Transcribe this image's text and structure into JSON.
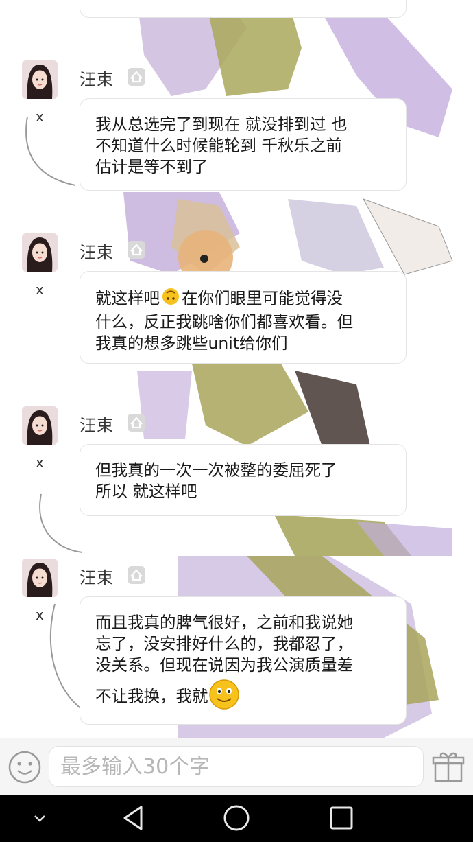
{
  "messages": [
    {
      "name": "汪束",
      "mark": "x",
      "lines": [
        "我从总选完了到现在 就没排到过 也",
        "不知道什么时候能轮到 千秋乐之前",
        "估计是等不到了"
      ]
    },
    {
      "name": "汪束",
      "mark": "x",
      "lines_a": "就这样吧",
      "emoji_a": "upside-down-face",
      "lines_b": "在你们眼里可能觉得没",
      "lines_rest": [
        "什么，反正我跳啥你们都喜欢看。但",
        "我真的想多跳些unit给你们"
      ]
    },
    {
      "name": "汪束",
      "mark": "x",
      "lines": [
        "但我真的一次一次被整的委屈死了",
        "所以 就这样吧"
      ]
    },
    {
      "name": "汪束",
      "mark": "x",
      "lines": [
        "而且我真的脾气很好，之前和我说她",
        "忘了，没安排好什么的，我都忍了，",
        "没关系。但现在说因为我公演质量差"
      ],
      "last_line": "不让我换，我就",
      "last_emoji": "smile-emoji"
    }
  ],
  "input": {
    "placeholder": "最多输入30个字"
  },
  "icons": {
    "emoji_button": "smiley-icon",
    "gift_button": "gift-icon",
    "nav_down": "chevron-down-icon",
    "nav_back": "back-triangle-icon",
    "nav_home": "home-circle-icon",
    "nav_recents": "recents-square-icon"
  },
  "colors": {
    "nav_bg": "#000000",
    "input_bg": "#f5f5f5",
    "emoji_yellow": "#f7c21b"
  }
}
